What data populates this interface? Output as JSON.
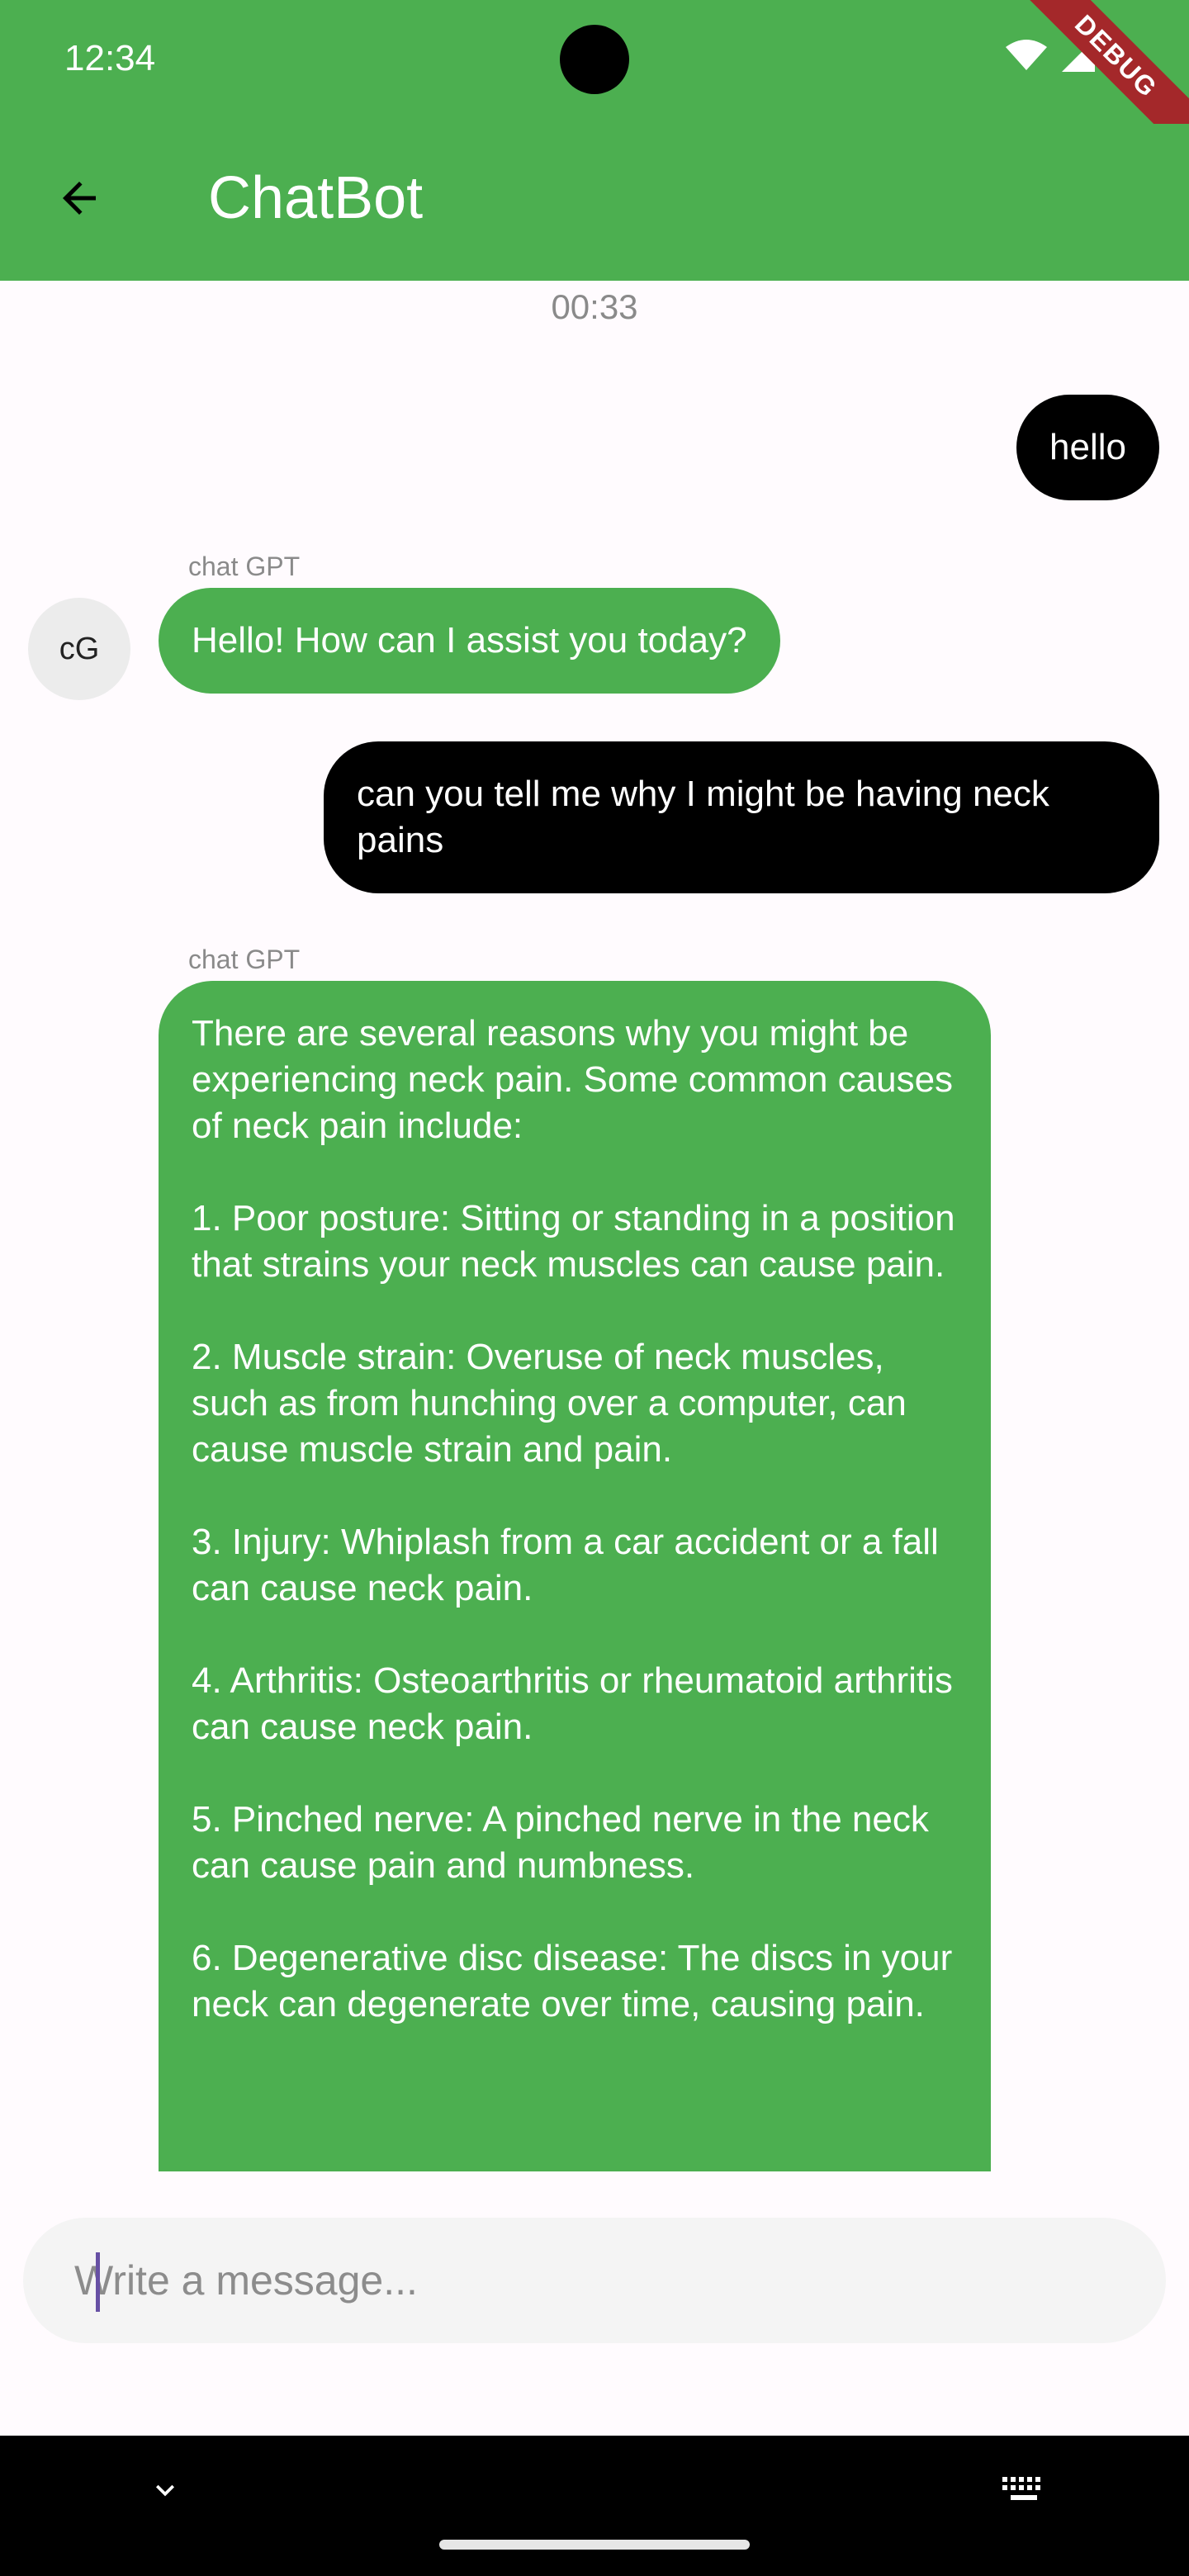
{
  "status_bar": {
    "time": "12:34",
    "debug_label": "DEBUG"
  },
  "app_bar": {
    "title": "ChatBot"
  },
  "chat": {
    "timestamp": "00:33",
    "messages": [
      {
        "role": "user",
        "text": "hello"
      },
      {
        "role": "bot",
        "sender": "chat GPT",
        "avatar": "cG",
        "text": "Hello! How can I assist you today?"
      },
      {
        "role": "user",
        "text": "can you tell me why I might be having neck pains"
      },
      {
        "role": "bot",
        "sender": "chat GPT",
        "text": "There are several reasons why you might be experiencing neck pain. Some common causes of neck pain include:\n\n1. Poor posture: Sitting or standing in a position that strains your neck muscles can cause pain.\n\n2. Muscle strain: Overuse of neck muscles, such as from hunching over a computer, can cause muscle strain and pain.\n\n3. Injury: Whiplash from a car accident or a fall can cause neck pain.\n\n4. Arthritis: Osteoarthritis or rheumatoid arthritis can cause neck pain.\n\n5. Pinched nerve: A pinched nerve in the neck can cause pain and numbness.\n\n6. Degenerative disc disease: The discs in your neck can degenerate over time, causing pain."
      }
    ]
  },
  "composer": {
    "placeholder": "Write a message..."
  },
  "icons": {
    "back": "arrow-left-icon",
    "wifi": "wifi-icon",
    "signal": "cellular-signal-icon",
    "battery": "battery-icon",
    "nav_down": "chevron-down-icon",
    "keyboard": "keyboard-icon"
  },
  "colors": {
    "app_bar": "#4caf50",
    "bot_bubble": "#4caf50",
    "user_bubble": "#000000",
    "background": "#fffbfe",
    "caret": "#6750a4"
  }
}
